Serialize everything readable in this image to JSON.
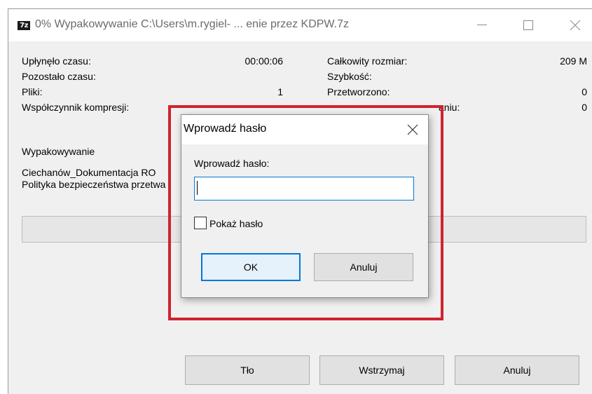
{
  "window": {
    "app_icon_text": "7z",
    "title": "0% Wypakowywanie C:\\Users\\m.rygiel- ... enie przez KDPW.7z"
  },
  "stats": {
    "elapsed_label": "Upłynęło czasu:",
    "elapsed_value": "00:00:06",
    "remaining_label": "Pozostało czasu:",
    "files_label": "Pliki:",
    "files_value": "1",
    "ratio_label": "Współczynnik kompresji:",
    "total_size_label": "Całkowity rozmiar:",
    "total_size_value": "209 M",
    "speed_label": "Szybkość:",
    "processed_label": "Przetworzono:",
    "processed_value": "0",
    "packed_label_partial": "aniu:",
    "packed_value": "0"
  },
  "operation": {
    "label": "Wypakowywanie",
    "file_line1": "Ciechanów_Dokumentacja RO",
    "file_line2": "Polityka bezpieczeństwa przetwa",
    "progress": 0
  },
  "buttons": {
    "background": "Tło",
    "pause": "Wstrzymaj",
    "cancel": "Anuluj"
  },
  "dialog": {
    "title": "Wprowadź hasło",
    "prompt": "Wprowadź hasło:",
    "password_value": "",
    "show_password_label": "Pokaż hasło",
    "show_password_checked": false,
    "ok": "OK",
    "cancel": "Anuluj"
  },
  "colors": {
    "highlight": "#d0232f",
    "focus": "#0078d7"
  }
}
